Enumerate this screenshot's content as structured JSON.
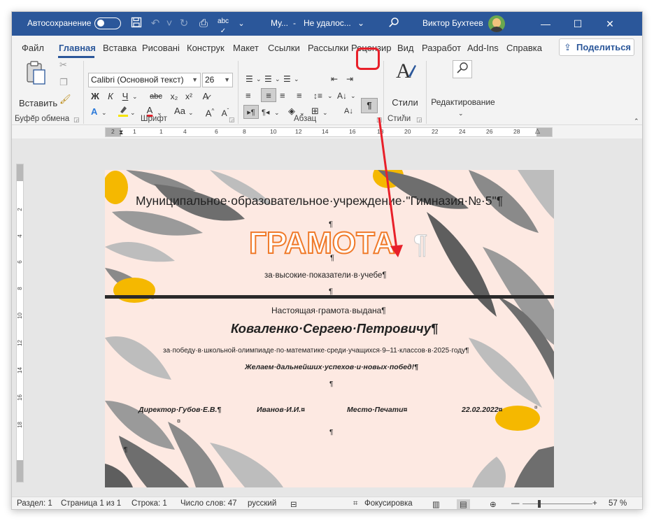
{
  "titlebar": {
    "autosave_label": "Автосохранение",
    "doc_name": "Му...",
    "save_status": "Не удалос...",
    "user_name": "Виктор Бухтеев",
    "minimize": "—",
    "maximize": "☐",
    "close": "✕"
  },
  "tabs": [
    "Файл",
    "Главная",
    "Вставка",
    "Рисовані",
    "Конструк",
    "Макет",
    "Ссылки",
    "Рассылки",
    "Рецензир",
    "Вид",
    "Разработ",
    "Add-Ins",
    "Справка"
  ],
  "share_label": "Поделиться",
  "ribbon": {
    "clipboard": {
      "paste_label": "Вставить",
      "group_label": "Буфер обмена"
    },
    "font": {
      "font_name": "Calibri (Основной текст)",
      "font_size": "26",
      "bold": "Ж",
      "italic": "К",
      "underline": "Ч",
      "strike": "abc",
      "sub": "x₂",
      "sup": "x²",
      "group_label": "Шрифт"
    },
    "paragraph": {
      "pilcrow": "¶",
      "group_label": "Абзац"
    },
    "styles": {
      "label": "Стили",
      "group_label": "Стили"
    },
    "editing": {
      "label": "Редактирование"
    }
  },
  "ruler_numbers": [
    "2",
    "1",
    "1",
    "2",
    "4",
    "6",
    "8",
    "10",
    "12",
    "14",
    "16",
    "18",
    "20",
    "22",
    "24",
    "26",
    "28"
  ],
  "vruler_numbers": [
    "2",
    "4",
    "6",
    "8",
    "10",
    "12",
    "14",
    "16",
    "18"
  ],
  "document": {
    "institution": "Муниципальное·образовательное·учреждение·\"Гимназия·№·5\"¶",
    "pil1": "¶",
    "title": "ГРАМОТА",
    "title_mark": "¶",
    "pil2": "¶",
    "subtitle": "за·высокие·показатели·в·учебе¶",
    "pil3": "¶",
    "given_to": "Настоящая·грамота·выдана¶",
    "recipient": "Коваленко·Сергею·Петровичу¶",
    "reason": "за·победу·в·школьной·олимпиаде·по·математике·среди·учащихся·9–11·классов·в·2025·году¶",
    "wishes": "Желаем·дальнейших·успехов·и·новых·побед!¶",
    "pil4": "¶",
    "director": "Директор·Губов·Е.В.¶",
    "director_mark": "¤",
    "ivanov": "Иванов·И.И.¤",
    "stamp": "Место·Печати¤",
    "date": "22.02.2022¤",
    "date_mark": "¤",
    "pil5": "¶",
    "pil6": "¶"
  },
  "statusbar": {
    "section": "Раздел: 1",
    "page": "Страница 1 из 1",
    "line": "Строка: 1",
    "words": "Число слов: 47",
    "language": "русский",
    "focus": "Фокусировка",
    "zoom": "57 %"
  },
  "colors": {
    "titlebar": "#2b579a",
    "highlight": "#e8202a",
    "page_bg": "#fde9e2",
    "title_orange": "#f07a2a",
    "leaf_grey": "#6e6e6e",
    "leaf_light": "#bdbdbd",
    "accent_yellow": "#f5b800"
  }
}
